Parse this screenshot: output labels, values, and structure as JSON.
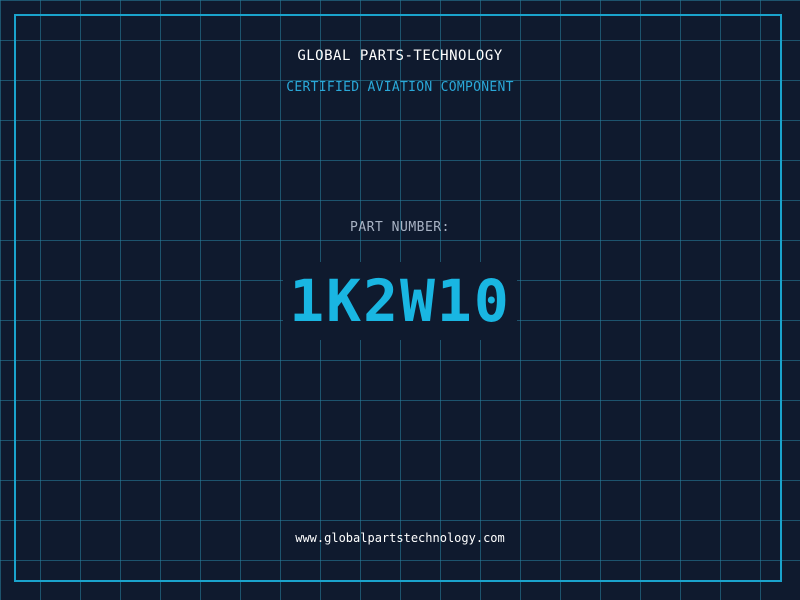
{
  "header": {
    "company": "GLOBAL PARTS-TECHNOLOGY",
    "certification": "CERTIFIED AVIATION COMPONENT"
  },
  "part": {
    "label": "PART NUMBER:",
    "number": "1K2W10"
  },
  "footer": {
    "website": "www.globalpartstechnology.com"
  },
  "colors": {
    "background": "#0f1a2e",
    "grid": "#28829f",
    "accent": "#19b6e2",
    "frame": "#1aa3cc"
  }
}
